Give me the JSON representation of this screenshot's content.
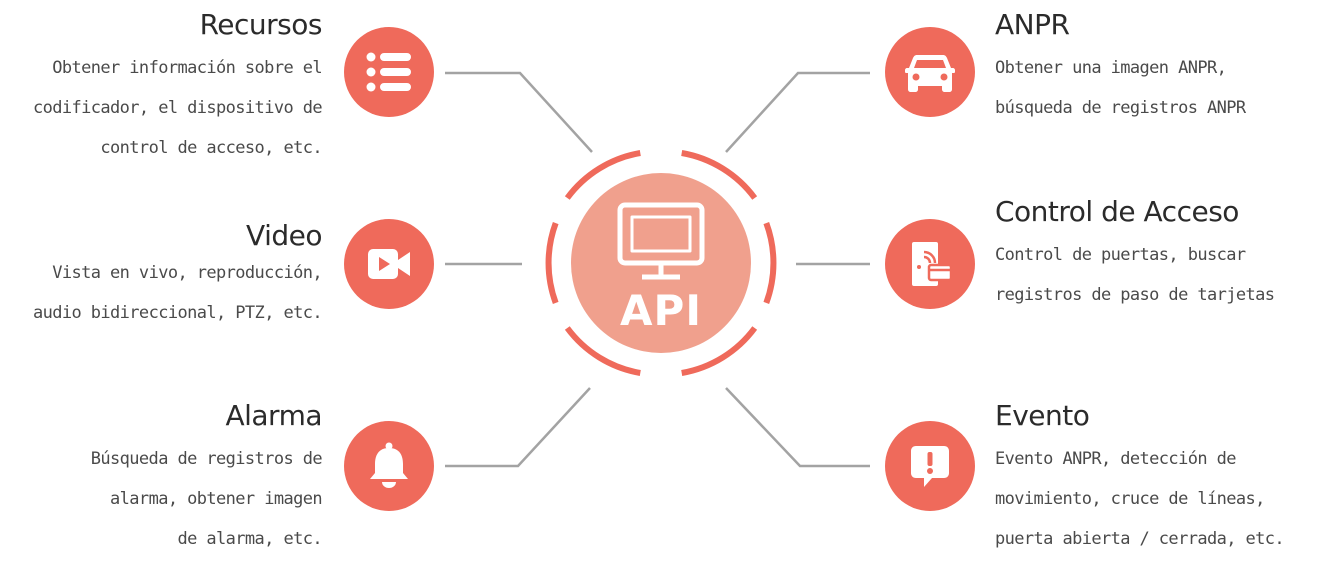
{
  "center": {
    "label": "API",
    "icon": "monitor-icon"
  },
  "colors": {
    "accent": "#ef6a5b",
    "center_fill": "#f0a08d",
    "line": "#a3a3a3"
  },
  "nodes": {
    "recursos": {
      "title": "Recursos",
      "lines": [
        "Obtener información sobre el",
        "codificador, el dispositivo de",
        "control de acceso, etc."
      ],
      "icon": "list-icon"
    },
    "video": {
      "title": "Video",
      "lines": [
        "Vista en vivo, reproducción,",
        "audio bidireccional, PTZ, etc."
      ],
      "icon": "video-camera-icon"
    },
    "alarma": {
      "title": "Alarma",
      "lines": [
        "Búsqueda de registros de",
        "alarma, obtener imagen",
        "de alarma, etc."
      ],
      "icon": "bell-icon"
    },
    "anpr": {
      "title": "ANPR",
      "lines": [
        "Obtener una imagen ANPR,",
        "búsqueda de registros ANPR"
      ],
      "icon": "car-icon"
    },
    "control": {
      "title": "Control de Acceso",
      "lines": [
        "Control de puertas, buscar",
        "registros de paso de tarjetas"
      ],
      "icon": "card-door-icon"
    },
    "evento": {
      "title": "Evento",
      "lines": [
        "Evento ANPR, detección de",
        "movimiento, cruce de líneas,",
        "puerta abierta / cerrada, etc."
      ],
      "icon": "alert-message-icon"
    }
  }
}
